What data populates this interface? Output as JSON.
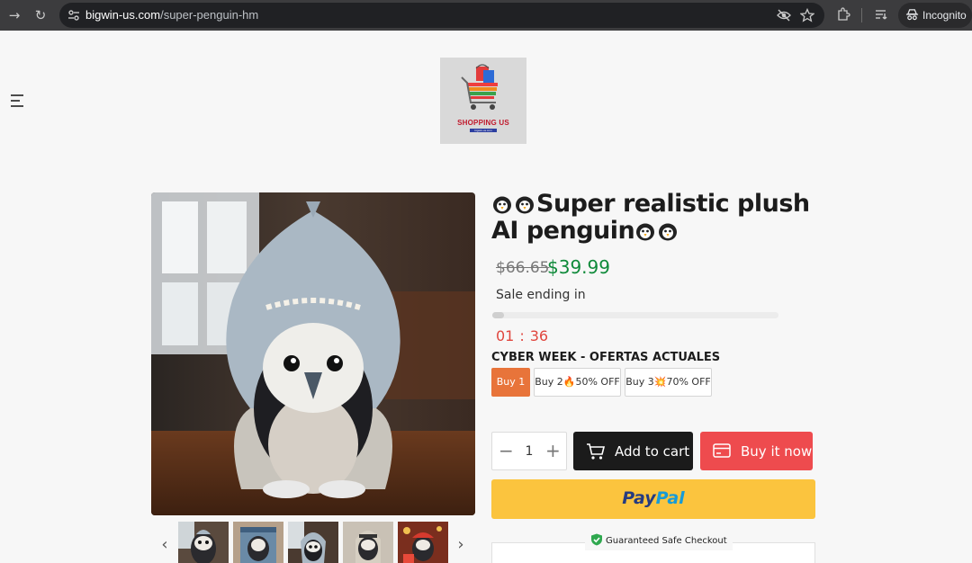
{
  "browser": {
    "url_host": "bigwin-us.com",
    "url_path": "/super-penguin-hm",
    "incognito_label": "Incognito"
  },
  "logo": {
    "text": "SHOPPING US",
    "subtext": "bigwin-us.com"
  },
  "product": {
    "title": "Super realistic plush AI penguin",
    "price_old": "$66.65",
    "price_new": "$39.99",
    "sale_label": "Sale ending in",
    "sale_progress": 0.04,
    "timer_minutes": "01",
    "timer_seconds": "36",
    "offer_title": "CYBER WEEK - OFERTAS ACTUALES",
    "options": [
      {
        "label": "Buy 1",
        "selected": true
      },
      {
        "label": "Buy 2🔥50% OFF",
        "selected": false
      },
      {
        "label": "Buy 3💥70% OFF",
        "selected": false
      }
    ],
    "quantity": "1"
  },
  "actions": {
    "add_to_cart": "Add to cart",
    "buy_now": "Buy it now",
    "paypal_pay": "Pay",
    "paypal_pal": "Pal"
  },
  "checkout": {
    "safe_label": "Guaranteed Safe Checkout"
  },
  "colors": {
    "accent_orange": "#e8743a",
    "price_green": "#0f8a3a",
    "timer_red": "#e0463e",
    "buy_now_red": "#ee4b4e",
    "paypal_yellow": "#fbc43e"
  },
  "icons": {
    "menu": "hamburger-icon",
    "cart": "cart-icon",
    "card": "credit-card-icon",
    "shield": "shield-check-icon"
  }
}
